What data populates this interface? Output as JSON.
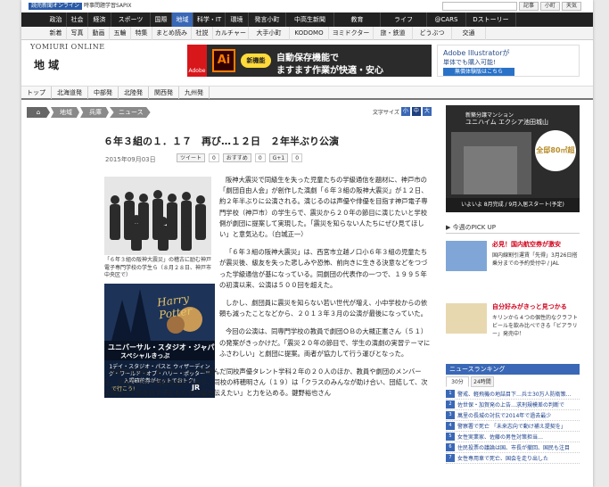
{
  "topbar": {
    "ad_left": "読売新聞オンライン",
    "ad_text": "時事問題学習SAPIX",
    "search_btn": "記事",
    "btn_small": "小町",
    "btn_weather": "天気"
  },
  "nav1": [
    "政治",
    "社会",
    "経済",
    "スポーツ",
    "国際",
    "地域",
    "科学・IT",
    "環境",
    "発言小町",
    "中高生新聞",
    "教育",
    "ライフ",
    "@CARS",
    "Dストーリー"
  ],
  "nav1_active": "地域",
  "nav2": [
    "新着",
    "写真",
    "動画",
    "五輪",
    "特集",
    "まとめ読み",
    "社説",
    "カルチャー",
    "大手小町",
    "KODOMO",
    "ヨミドクター",
    "旅・鉄道",
    "どうぶつ",
    "交通"
  ],
  "brand": "YOMIURI ONLINE",
  "section_title": "地 域",
  "banner": {
    "logo": "Adobe",
    "app": "Ai",
    "badge": "新機能",
    "line1": "自動保存機能で",
    "line2": "ますます作業が快適・安心"
  },
  "side_ad": {
    "line1": "Adobe Illustratorが",
    "line2": "単体でも購入可能!",
    "cta": "無償体験版はこちら"
  },
  "tabs": [
    "トップ",
    "北海道発",
    "中部発",
    "北陸発",
    "関西発",
    "九州発"
  ],
  "breadcrumb": [
    "地域",
    "兵庫",
    "ニュース"
  ],
  "font_size": {
    "label": "文字サイズ",
    "small": "小",
    "medium": "中",
    "large": "大"
  },
  "article": {
    "headline": "６年３組の１．１７　再び…１２日　２年半ぶり公演",
    "date": "2015年09月03日",
    "tweet_label": "ツイート",
    "tweet_count": "0",
    "hatena_label": "おすすめ",
    "hatena_count": "0",
    "gplus_label": "G+1",
    "gplus_count": "0",
    "caption": "「６年３組の阪神大震災」の稽古に励む神戸電子専門学校の学生ら（８月２８日、神戸市中央区で）",
    "paragraphs": [
      "阪神大震災で同級生を失った児童たちの学級通信を題材に、神戸市の「劇団自由人会」が創作した演劇「６年３組の阪神大震災」が１２日、約２年半ぶりに公演される。演じるのは声優や俳優を目指す神戸電子専門学校（神戸市）の学生らで、震災から２０年の節目に演じたいと学校側が劇団に提案して実現した。「震災を知らない人たちにぜひ見てほしい」と意気込む。（白城正一）",
      "「６年３組の阪神大震災」は、西宮市立越ノ口小６年３組の児童たちが震災後、級友を失った悲しみや恐怖、前向きに生きる決意などをつづった学級通信が基になっている。同劇団の代表作の一つで、１９９５年の初演以来、公演は５００回を超えた。",
      "しかし、劇団員に震災を知らない若い世代が増え、小中学校からの依頼も減ったことなどから、２０１３年３月の公演が最後になっていた。",
      "今回の公演は、同専門学校の教員で劇団ＯＢの大槻正憲さん（５１）の発案がきっかけだ。「震災２０年の節目で、学生の演劇の実習テーマにふさわしい」と劇団に提案。両者が協力して行う運びとなった。",
      "出演するのは、オーディションで選んだ同校声優タレント学科２年の２０人のほか、教員や劇団のメンバーら。８月６日から稽古を続けており、同校の柿穂明さん（１９）は「クラスのみんなが助け合い、団結して、次に向かって歩き出す子どもたちの姿を伝えたい」と力を込める。鍵野裕也さん"
    ]
  },
  "article_ad": {
    "title": "Harry Potter",
    "line1": "ユニバーサル・スタジオ・ジャパン",
    "line2": "スペシャルきっぷ",
    "line3": "1デイ・スタジオ・パスと ウィザーディング・ワールド・オブ・ハリー・ポッター™ 入場確約券がセットでおトク!",
    "line4": "で行こう!",
    "logo": "JR"
  },
  "right_ad": {
    "line1": "新築分譲マンション",
    "line2": "ユニハイム エクシア池田城山",
    "price": "全邸80㎡超",
    "info": "いよいよ 8月完成 / 9月入居スタート(予定)"
  },
  "pickup": {
    "heading": "今週のPICK UP",
    "items": [
      {
        "title": "必見！国内航空券が激安",
        "sub": "国内線割引運賃「先得」3月26日搭乗分までの予約受付中 / JAL"
      },
      {
        "title": "自分好みがきっと見つかる",
        "sub": "キリンから４つの個性的なクラフトビールを飲み比べできる「ビアラリー」発売中！"
      }
    ]
  },
  "ranking": {
    "heading": "ニュースランキング",
    "tabs": [
      "30分",
      "24時間"
    ],
    "items": [
      "警戒、軽飛機の地詰目下…兵士30万人防衛策…",
      "佐世保・加賀発の上告…求刑規模差の判断で",
      "萬里の長城の対抗で2014年で過去最少",
      "警察署で死亡 「未来志向で動け補え提契を」",
      "女性実業家、佐藤の男性対策担当…",
      "住民投票の議論は国、市長が撤回、国民も注目",
      "女性専用車で死亡、国会を走り出した"
    ]
  }
}
